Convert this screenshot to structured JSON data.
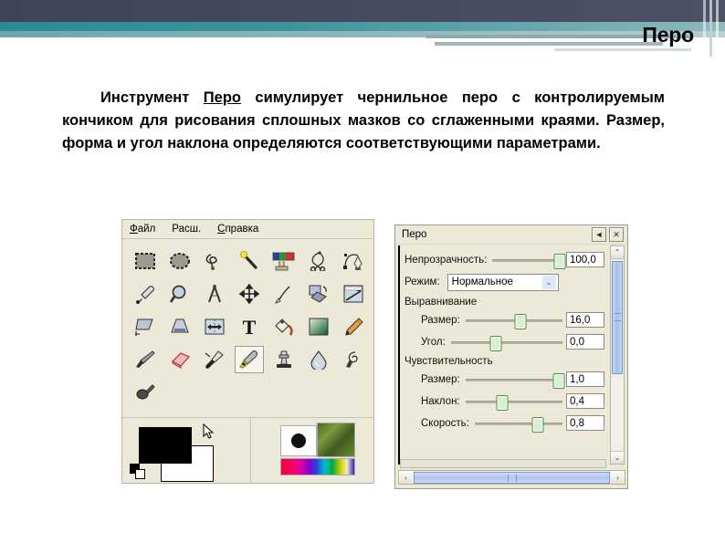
{
  "slide": {
    "title": "Перо",
    "body_prefix": "Инструмент ",
    "body_keyword": "Перо",
    "body_rest": " симулирует чернильное перо с контролируемым кончиком для рисования сплошных мазков со сглаженными краями. Размер, форма и угол наклона определяются соответствующими параметрами."
  },
  "toolbox": {
    "menu": [
      {
        "name": "file",
        "label": "Файл",
        "accel": "Ф",
        "tail": "айл"
      },
      {
        "name": "extensions",
        "label": "Расш.",
        "accel": "",
        "tail": "Расш."
      },
      {
        "name": "help",
        "label": "Справка",
        "accel": "С",
        "tail": "правка"
      }
    ],
    "tools": [
      {
        "name": "rect-select-icon",
        "label": "Прямоугольное выделение",
        "selected": false
      },
      {
        "name": "ellipse-select-icon",
        "label": "Эллиптическое выделение",
        "selected": false
      },
      {
        "name": "free-select-icon",
        "label": "Свободное выделение",
        "selected": false
      },
      {
        "name": "fuzzy-select-icon",
        "label": "Выделение связанной области",
        "selected": false
      },
      {
        "name": "by-color-select-icon",
        "label": "Выделение по цвету",
        "selected": false
      },
      {
        "name": "scissors-select-icon",
        "label": "Умные ножницы",
        "selected": false
      },
      {
        "name": "paths-icon",
        "label": "Контуры",
        "selected": false
      },
      {
        "name": "color-picker-icon",
        "label": "Пипетка",
        "selected": false
      },
      {
        "name": "zoom-icon",
        "label": "Лупа",
        "selected": false
      },
      {
        "name": "measure-icon",
        "label": "Измеритель",
        "selected": false
      },
      {
        "name": "move-icon",
        "label": "Перемещение",
        "selected": false
      },
      {
        "name": "align-icon",
        "label": "Выравнивание",
        "selected": false
      },
      {
        "name": "rotate-icon",
        "label": "Вращение",
        "selected": false
      },
      {
        "name": "crop-icon",
        "label": "Кадрирование",
        "selected": false
      },
      {
        "name": "shear-icon",
        "label": "Искривление",
        "selected": false
      },
      {
        "name": "perspective-icon",
        "label": "Перспектива",
        "selected": false
      },
      {
        "name": "flip-icon",
        "label": "Зеркало",
        "selected": false
      },
      {
        "name": "text-icon",
        "label": "Текст",
        "selected": false
      },
      {
        "name": "bucket-fill-icon",
        "label": "Плоская заливка",
        "selected": false
      },
      {
        "name": "gradient-icon",
        "label": "Градиент",
        "selected": false
      },
      {
        "name": "pencil-icon",
        "label": "Карандаш",
        "selected": false
      },
      {
        "name": "paintbrush-icon",
        "label": "Кисть",
        "selected": false
      },
      {
        "name": "eraser-icon",
        "label": "Ластик",
        "selected": false
      },
      {
        "name": "airbrush-icon",
        "label": "Аэрограф",
        "selected": false
      },
      {
        "name": "ink-icon",
        "label": "Перо",
        "selected": true
      },
      {
        "name": "clone-icon",
        "label": "Штамп",
        "selected": false
      },
      {
        "name": "blur-sharpen-icon",
        "label": "Размывание/Резкость",
        "selected": false
      },
      {
        "name": "smudge-icon",
        "label": "Палец",
        "selected": false
      },
      {
        "name": "dodge-burn-icon",
        "label": "Осветление/Затемнение",
        "selected": false
      }
    ]
  },
  "ink_dialog": {
    "title": "Перо",
    "titlebar_buttons": [
      {
        "name": "menu-button",
        "glyph": "◄"
      },
      {
        "name": "close-button",
        "glyph": "✕"
      }
    ],
    "opacity": {
      "label": "Непрозрачность:",
      "value": "100,0",
      "slider_pct": 96
    },
    "mode": {
      "label": "Режим:",
      "value": "Нормальное",
      "arrow": "⌄"
    },
    "adjustment": {
      "heading": "Выравнивание",
      "rows": [
        {
          "name": "size",
          "label": "Размер:",
          "value": "16,0",
          "slider_pct": 57
        },
        {
          "name": "angle",
          "label": "Угол:",
          "value": "0,0",
          "slider_pct": 40
        }
      ]
    },
    "sensitivity": {
      "heading": "Чувствительность",
      "rows": [
        {
          "name": "size",
          "label": "Размер:",
          "value": "1,0",
          "slider_pct": 96
        },
        {
          "name": "tilt",
          "label": "Наклон:",
          "value": "0,4",
          "slider_pct": 38
        },
        {
          "name": "speed",
          "label": "Скорость:",
          "value": "0,8",
          "slider_pct": 72
        }
      ]
    },
    "scroll": {
      "up_glyph": "⌃",
      "down_glyph": "⌄",
      "left_glyph": "‹",
      "right_glyph": "›"
    }
  },
  "colors": {
    "header_dark": "#454a5e",
    "header_teal": "#2e8a92",
    "window_face": "#ece9d8",
    "foreground": "#000000",
    "background": "#ffffff",
    "slider_thumb": "#d8f0d0",
    "scroll_thumb": "#a8bfee"
  }
}
